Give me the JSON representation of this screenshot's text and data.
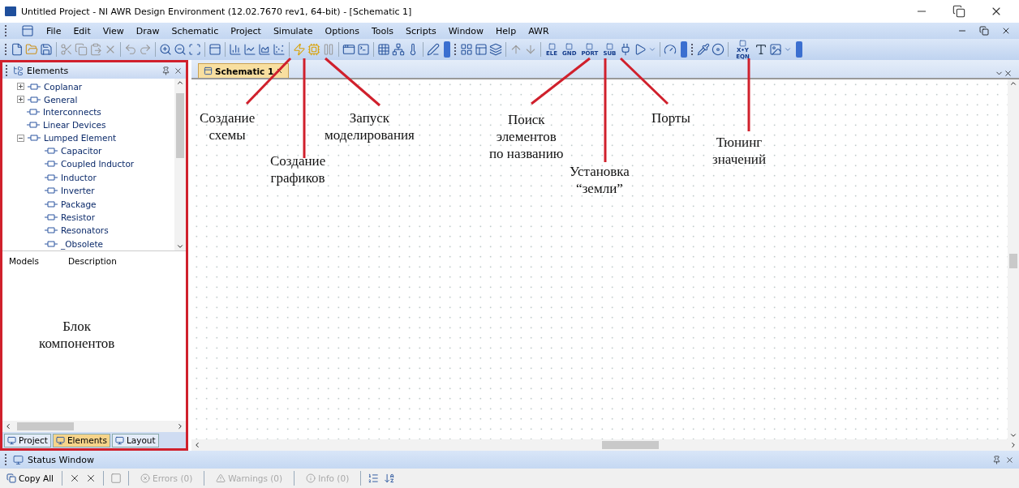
{
  "window": {
    "title": "Untitled Project - NI AWR Design Environment (12.02.7670 rev1, 64-bit) - [Schematic 1]"
  },
  "menu": [
    "File",
    "Edit",
    "View",
    "Draw",
    "Schematic",
    "Project",
    "Simulate",
    "Options",
    "Tools",
    "Scripts",
    "Window",
    "Help",
    "AWR"
  ],
  "toolbar": {
    "captions": [
      "ELE",
      "GND",
      "PORT",
      "SUB",
      "X•Y EQN"
    ]
  },
  "elements_panel": {
    "title": "Elements",
    "tree": [
      {
        "label": "Coplanar",
        "expanded": false
      },
      {
        "label": "General",
        "expanded": false
      },
      {
        "label": "Interconnects"
      },
      {
        "label": "Linear Devices"
      },
      {
        "label": "Lumped Element",
        "expanded": true,
        "children": [
          {
            "label": "Capacitor"
          },
          {
            "label": "Coupled Inductor"
          },
          {
            "label": "Inductor"
          },
          {
            "label": "Inverter"
          },
          {
            "label": "Package"
          },
          {
            "label": "Resistor"
          },
          {
            "label": "Resonators"
          },
          {
            "label": "_Obsolete"
          }
        ]
      }
    ],
    "columns": [
      "Models",
      "Description"
    ],
    "tabs": [
      {
        "label": "Project",
        "selected": false
      },
      {
        "label": "Elements",
        "selected": true
      },
      {
        "label": "Layout",
        "selected": false
      }
    ]
  },
  "document_tabs": [
    {
      "label": "Schematic 1",
      "selected": true
    }
  ],
  "annotations": [
    {
      "text": "Создание\nсхемы"
    },
    {
      "text": "Создание\nграфиков"
    },
    {
      "text": "Запуск\nмоделирования"
    },
    {
      "text": "Поиск\nэлементов\nпо названию"
    },
    {
      "text": "Установка\n“земли”"
    },
    {
      "text": "Порты"
    },
    {
      "text": "Тюнинг\nзначений"
    },
    {
      "text": "Блок\nкомпонентов"
    }
  ],
  "status_window": {
    "title": "Status Window",
    "copy_label": "Copy All",
    "filters": [
      {
        "label": "Errors (0)",
        "disabled": true
      },
      {
        "label": "Warnings (0)",
        "disabled": true
      },
      {
        "label": "Info (0)",
        "disabled": true
      }
    ]
  }
}
